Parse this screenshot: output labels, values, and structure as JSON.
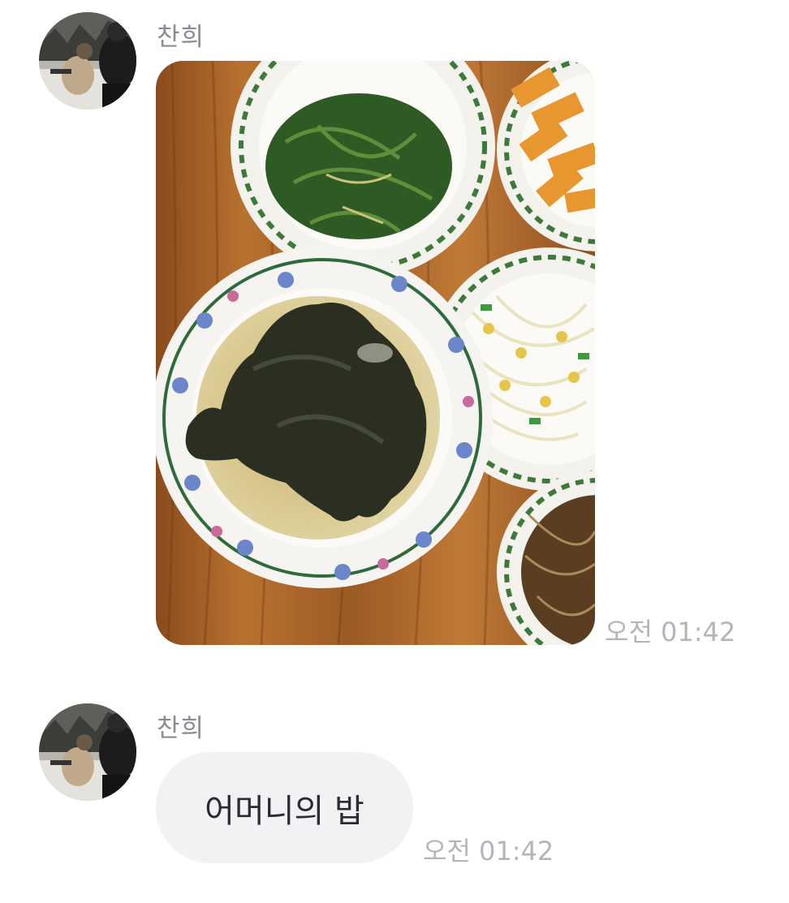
{
  "messages": [
    {
      "sender": "찬희",
      "avatar": "profile-photo",
      "content_type": "photo",
      "photo_subject": "food-photo",
      "time": "오전 01:42"
    },
    {
      "sender": "찬희",
      "avatar": "profile-photo",
      "content_type": "text",
      "text": "어머니의 밥",
      "time": "오전 01:42"
    }
  ],
  "colors": {
    "background": "#ffffff",
    "sender_name": "#8a8c93",
    "timestamp": "#b4b5ba",
    "bubble_background": "#f2f2f5",
    "bubble_text": "#2b2c31"
  }
}
